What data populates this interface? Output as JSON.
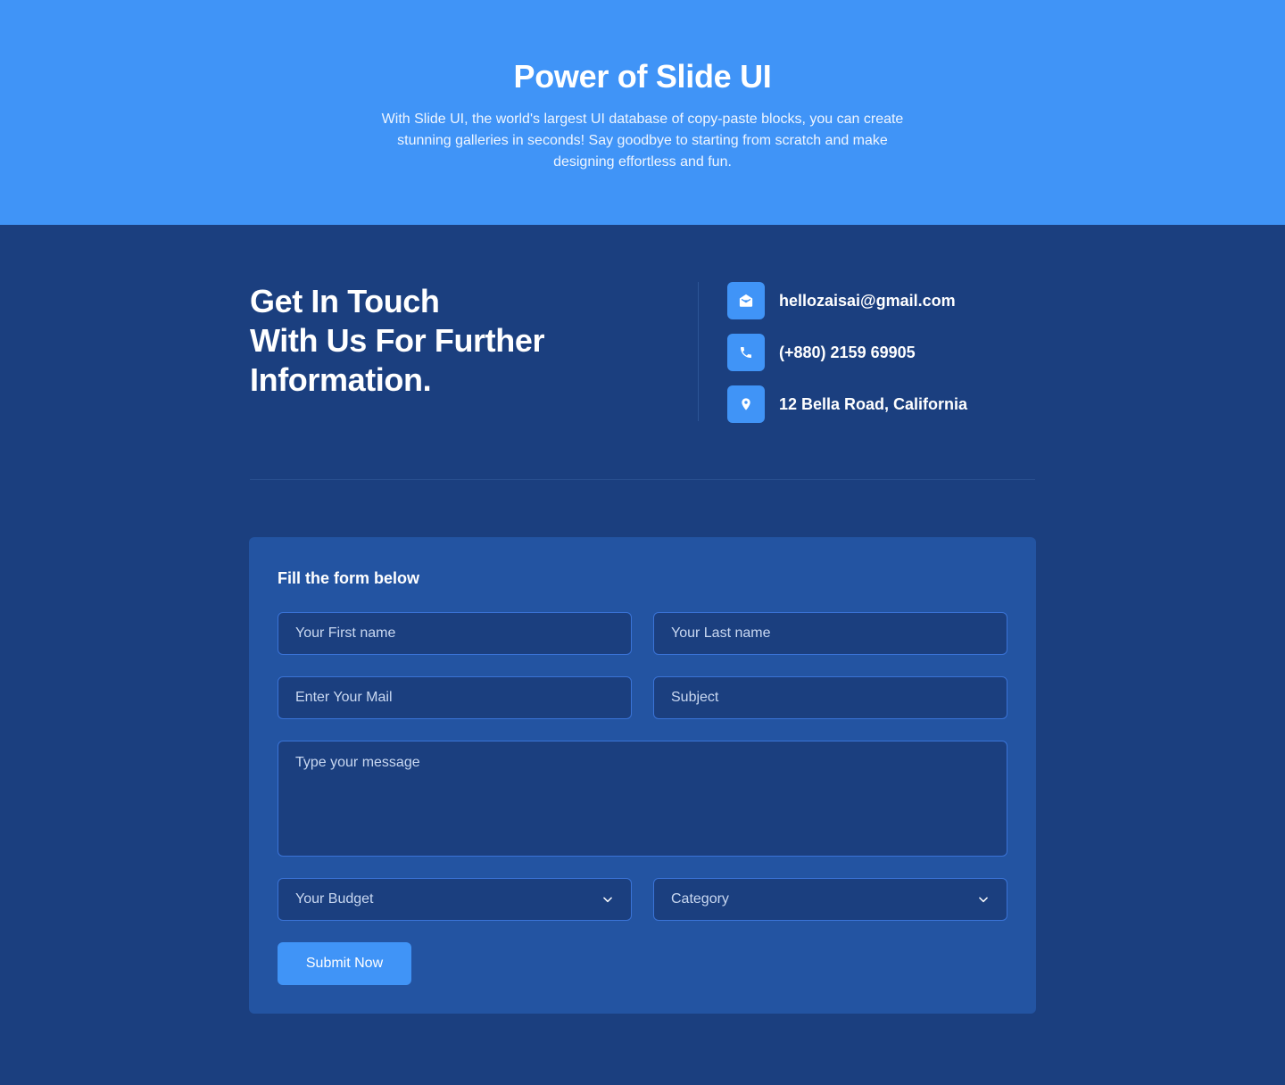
{
  "hero": {
    "title": "Power of Slide UI",
    "description": "With Slide UI, the world's largest UI database of copy-paste blocks, you can create stunning galleries in seconds! Say goodbye to starting from scratch and make designing effortless and fun."
  },
  "contact": {
    "headline_lines": [
      "Get In Touch",
      "With Us For Further",
      "Information."
    ],
    "email": {
      "icon": "mail-open-icon",
      "text": "hellozaisai@gmail.com"
    },
    "phone": {
      "icon": "phone-icon",
      "text": "(+880) 2159 69905"
    },
    "address": {
      "icon": "location-pin-icon",
      "text": "12 Bella Road, California"
    }
  },
  "form": {
    "title": "Fill the form below",
    "first_name_placeholder": "Your First name",
    "last_name_placeholder": "Your Last name",
    "email_placeholder": "Enter Your Mail",
    "subject_placeholder": "Subject",
    "message_placeholder": "Type your message",
    "budget_label": "Your Budget",
    "category_label": "Category",
    "submit_label": "Submit Now"
  },
  "colors": {
    "hero_bg": "#4094f7",
    "page_bg": "#1b3f7f",
    "card_bg": "#2354a2",
    "accent": "#4094f7",
    "field_border": "#3a73d6"
  }
}
